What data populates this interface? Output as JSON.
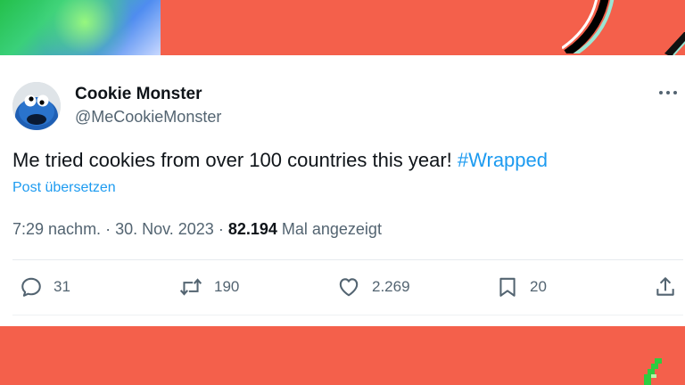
{
  "colors": {
    "background": "#f4604b",
    "accent": "#1d9bf0",
    "text_primary": "#0f1419",
    "text_secondary": "#536471"
  },
  "tweet": {
    "author_name": "Cookie Monster",
    "author_handle": "@MeCookieMonster",
    "text": "Me tried cookies from over 100 countries this year! ",
    "hashtag": "#Wrapped",
    "translate_label": "Post übersetzen",
    "time": "7:29 nachm.",
    "separator": " · ",
    "date": "30. Nov. 2023",
    "views_count": "82.194",
    "views_label": " Mal angezeigt",
    "more_icon": "more-horizontal-icon"
  },
  "actions": {
    "replies": {
      "icon": "reply-icon",
      "count": "31"
    },
    "reposts": {
      "icon": "repost-icon",
      "count": "190"
    },
    "likes": {
      "icon": "like-icon",
      "count": "2.269"
    },
    "bookmarks": {
      "icon": "bookmark-icon",
      "count": "20"
    },
    "share": {
      "icon": "share-icon"
    }
  }
}
